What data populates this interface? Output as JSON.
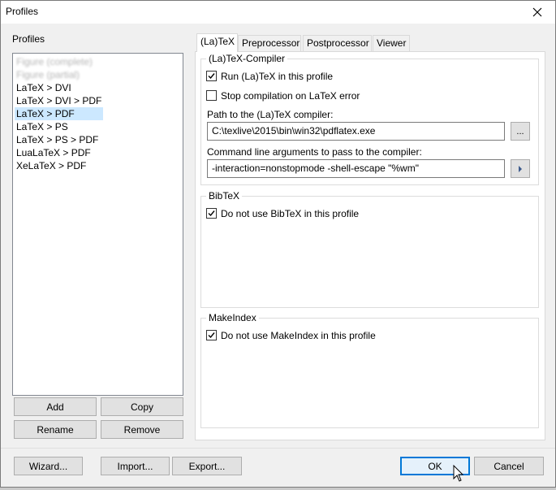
{
  "window": {
    "title": "Profiles",
    "close_icon": "close-icon"
  },
  "profiles": {
    "label": "Profiles",
    "items": [
      {
        "label": "Figure (complete)",
        "blurred": true
      },
      {
        "label": "Figure (partial)",
        "blurred": true
      },
      {
        "label": "LaTeX > DVI"
      },
      {
        "label": "LaTeX > DVI > PDF"
      },
      {
        "label": "LaTeX > PDF",
        "selected": true
      },
      {
        "label": "LaTeX > PS"
      },
      {
        "label": "LaTeX > PS > PDF"
      },
      {
        "label": "LuaLaTeX > PDF"
      },
      {
        "label": "XeLaTeX > PDF"
      }
    ],
    "buttons": {
      "add": "Add",
      "copy": "Copy",
      "rename": "Rename",
      "remove": "Remove"
    }
  },
  "tabs": [
    "(La)TeX",
    "Preprocessor",
    "Postprocessor",
    "Viewer"
  ],
  "latex_compiler": {
    "legend": "(La)TeX-Compiler",
    "run_label": "Run (La)TeX in this profile",
    "run_checked": true,
    "stop_label": "Stop compilation on LaTeX error",
    "stop_checked": false,
    "path_label": "Path to the (La)TeX compiler:",
    "path_value": "C:\\texlive\\2015\\bin\\win32\\pdflatex.exe",
    "browse_label": "...",
    "args_label": "Command line arguments to pass to the compiler:",
    "args_value": "-interaction=nonstopmode -shell-escape \"%wm\""
  },
  "bibtex": {
    "legend": "BibTeX",
    "checkbox_label": "Do not use BibTeX in this profile",
    "checked": true
  },
  "makeindex": {
    "legend": "MakeIndex",
    "checkbox_label": "Do not use MakeIndex in this profile",
    "checked": true
  },
  "footer": {
    "wizard": "Wizard...",
    "import": "Import...",
    "export": "Export...",
    "ok": "OK",
    "cancel": "Cancel"
  }
}
